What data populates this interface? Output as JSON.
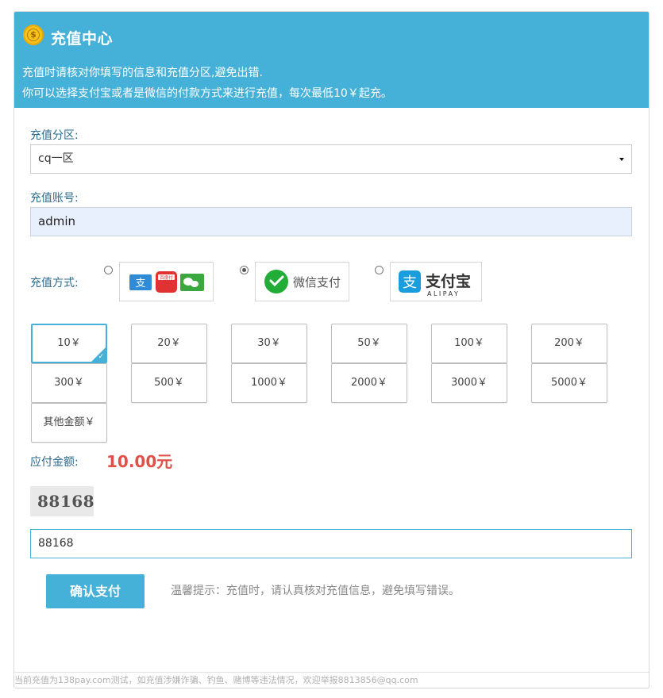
{
  "header": {
    "title": "充值中心",
    "notice_line1": "充值时请核对你填写的信息和充值分区,避免出错.",
    "notice_line2": "你可以选择支付宝或者是微信的付款方式来进行充值，每次最低10￥起充。"
  },
  "zone": {
    "label": "充值分区:",
    "value": "cq一区"
  },
  "account": {
    "label": "充值账号:",
    "value": "admin"
  },
  "payment": {
    "label": "充值方式:",
    "options": [
      {
        "name": "combined",
        "checked": false
      },
      {
        "name": "wechat",
        "text": "微信支付",
        "checked": true
      },
      {
        "name": "alipay",
        "text": "支付宝",
        "subtext": "ALIPAY",
        "checked": false
      }
    ],
    "mini_icon_text": "百度付"
  },
  "amounts": [
    {
      "label": "10￥",
      "selected": true
    },
    {
      "label": "20￥",
      "selected": false
    },
    {
      "label": "30￥",
      "selected": false
    },
    {
      "label": "50￥",
      "selected": false
    },
    {
      "label": "100￥",
      "selected": false
    },
    {
      "label": "200￥",
      "selected": false
    },
    {
      "label": "300￥",
      "selected": false
    },
    {
      "label": "500￥",
      "selected": false
    },
    {
      "label": "1000￥",
      "selected": false
    },
    {
      "label": "2000￥",
      "selected": false
    },
    {
      "label": "3000￥",
      "selected": false
    },
    {
      "label": "5000￥",
      "selected": false
    },
    {
      "label": "其他金额￥",
      "selected": false
    }
  ],
  "payable": {
    "label": "应付金额:",
    "value": "10.00元"
  },
  "captcha": {
    "image_text": "88168",
    "input_value": "88168"
  },
  "confirm_label": "确认支付",
  "tip": "温馨提示：充值时，请认真核对充值信息，避免填写错误。",
  "footer": "当前充值为138pay.com测试，如充值涉嫌诈骗、钓鱼、赌博等违法情况，欢迎举报8813856@qq.com",
  "colors": {
    "accent": "#46b1d8",
    "price": "#e0504a",
    "label": "#2b6b8e"
  }
}
